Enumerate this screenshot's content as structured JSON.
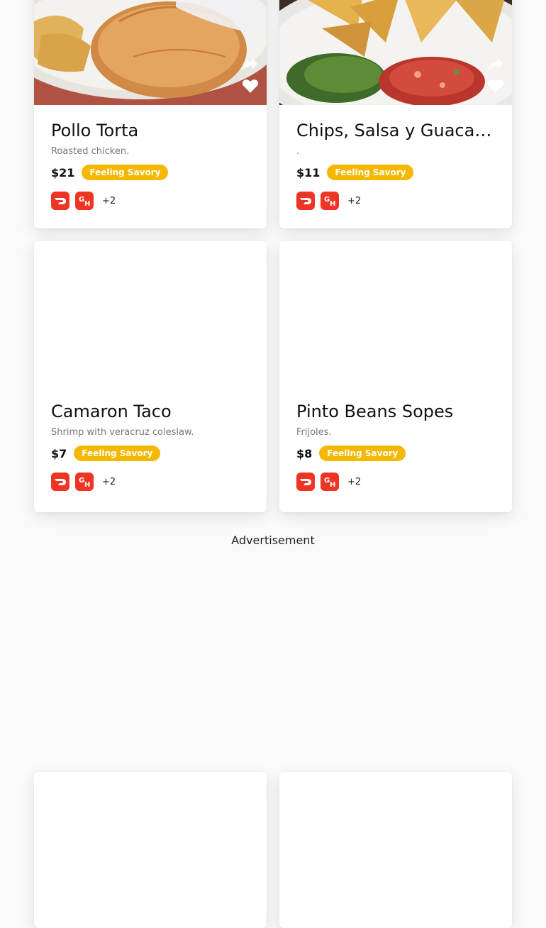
{
  "cards": [
    {
      "title": "Pollo Torta",
      "description": "Roasted chicken.",
      "price": "$21",
      "tag": "Feeling Savory",
      "services": [
        "doordash-icon",
        "grubhub-icon"
      ],
      "more_services": "+2"
    },
    {
      "title": "Chips, Salsa y Guacamole",
      "description": ".",
      "price": "$11",
      "tag": "Feeling Savory",
      "services": [
        "doordash-icon",
        "grubhub-icon"
      ],
      "more_services": "+2"
    },
    {
      "title": "Camaron Taco",
      "description": "Shrimp with veracruz coleslaw.",
      "price": "$7",
      "tag": "Feeling Savory",
      "services": [
        "doordash-icon",
        "grubhub-icon"
      ],
      "more_services": "+2"
    },
    {
      "title": "Pinto Beans Sopes",
      "description": "Frijoles.",
      "price": "$8",
      "tag": "Feeling Savory",
      "services": [
        "doordash-icon",
        "grubhub-icon"
      ],
      "more_services": "+2"
    }
  ],
  "advertisement_label": "Advertisement",
  "colors": {
    "tag_background": "#f5b800",
    "service_icon_red": "#ee3524",
    "page_background": "#fafafa"
  }
}
